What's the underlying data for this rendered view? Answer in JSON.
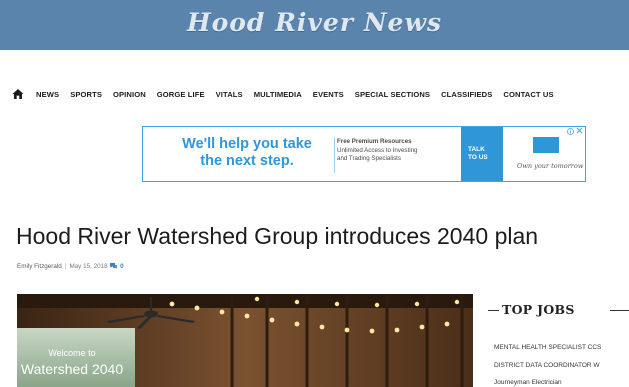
{
  "masthead": {
    "title": "Hood River News"
  },
  "nav": {
    "home_icon": "home-icon",
    "items": [
      "NEWS",
      "SPORTS",
      "OPINION",
      "GORGE LIFE",
      "VITALS",
      "MULTIMEDIA",
      "EVENTS",
      "SPECIAL SECTIONS",
      "CLASSIFIEDS",
      "CONTACT US"
    ]
  },
  "ad": {
    "headline_line1": "We'll help you take",
    "headline_line2": "the next step.",
    "copy_line1": "Free Premium Resources",
    "copy_line2": "Unlimited Access to Investing",
    "copy_line3": "and Trading Specialists",
    "cta_line1": "TALK",
    "cta_line2": "TO US",
    "brand_tagline": "Own your tomorrow",
    "info_icon": "ad-info-icon",
    "close_icon": "close-icon",
    "accent": "#2f96d8"
  },
  "article": {
    "title": "Hood River Watershed Group introduces 2040 plan",
    "author": "Emily Fitzgerald",
    "date": "May 15, 2018",
    "comments": "0",
    "photo_sign_line1": "Welcome to",
    "photo_sign_line2": "Watershed 2040"
  },
  "sidebar": {
    "heading": "TOP JOBS",
    "jobs": [
      "MENTAL HEALTH SPECIALIST CCS",
      "DISTRICT DATA COORDINATOR W",
      "Journeyman Electrician"
    ]
  },
  "colors": {
    "masthead_bg": "#5b84ad",
    "link_blue": "#3b7fc4"
  }
}
